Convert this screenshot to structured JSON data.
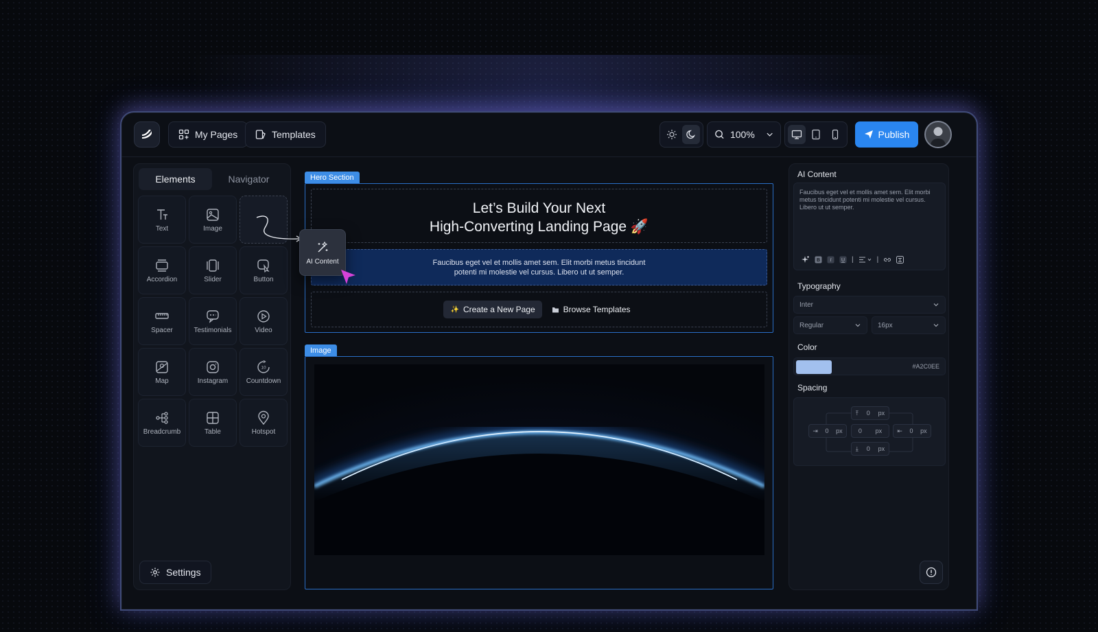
{
  "topbar": {
    "my_pages": "My Pages",
    "templates": "Templates",
    "zoom": "100%",
    "publish": "Publish"
  },
  "left_panel": {
    "tabs": [
      "Elements",
      "Navigator"
    ],
    "elements": [
      "Text",
      "Image",
      "",
      "Accordion",
      "Slider",
      "Button",
      "Spacer",
      "Testimonials",
      "Video",
      "Map",
      "Instagram",
      "Countdown",
      "Breadcrumb",
      "Table",
      "Hotspot"
    ],
    "settings": "Settings"
  },
  "drag_tile": {
    "label": "AI Content"
  },
  "canvas": {
    "hero_label": "Hero Section",
    "hero_title_1": "Let’s Build Your Next",
    "hero_title_2": "High-Converting Landing Page 🚀",
    "hero_desc_1": "Faucibus eget vel et mollis amet sem. Elit morbi metus tincidunt",
    "hero_desc_2": "potenti mi molestie vel cursus. Libero ut ut semper.",
    "btn_create": "Create a New Page",
    "btn_browse": "Browse Templates",
    "image_label": "Image"
  },
  "right_panel": {
    "ai_title": "AI Content",
    "ai_text": "Faucibus eget vel et mollis amet sem. Elit morbi metus tincidunt potenti mi molestie vel cursus. Libero ut ut semper.",
    "typography": "Typography",
    "font": "Inter",
    "weight": "Regular",
    "size": "16px",
    "color_title": "Color",
    "color_hex": "#A2C0EE",
    "spacing_title": "Spacing",
    "spacing": {
      "top": "0",
      "right": "0",
      "bottom": "0",
      "left": "0",
      "center": "0",
      "unit": "px"
    }
  },
  "colors": {
    "accent": "#2a86f0",
    "section_label": "#3d8de6",
    "swatch": "#a2c0ee"
  }
}
